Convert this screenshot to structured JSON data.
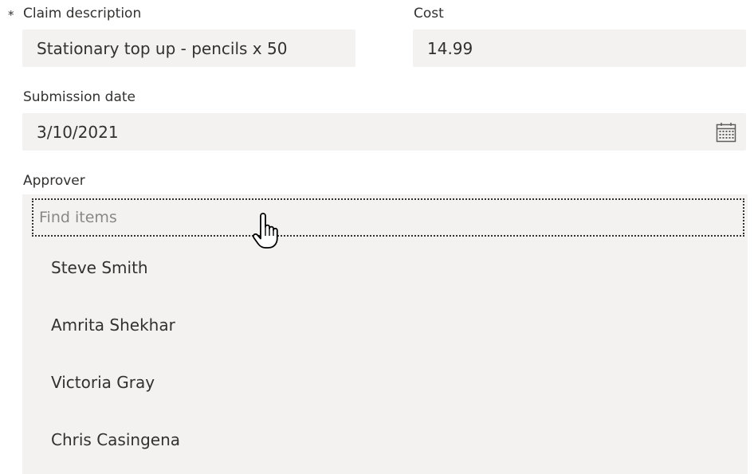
{
  "claim_description": {
    "required_marker": "*",
    "label": "Claim description",
    "value": "Stationary top up - pencils x 50"
  },
  "cost": {
    "label": "Cost",
    "value": "14.99"
  },
  "submission_date": {
    "label": "Submission date",
    "value": "3/10/2021",
    "icon": "calendar-icon"
  },
  "approver": {
    "label": "Approver",
    "search_placeholder": "Find items",
    "options": [
      {
        "label": "Steve Smith"
      },
      {
        "label": "Amrita Shekhar"
      },
      {
        "label": "Victoria Gray"
      },
      {
        "label": "Chris Casingena"
      }
    ]
  },
  "colors": {
    "field_background": "#f3f2f1",
    "text": "#323130",
    "placeholder": "#8a8886"
  },
  "cursor": {
    "icon": "hand-pointer-icon"
  }
}
